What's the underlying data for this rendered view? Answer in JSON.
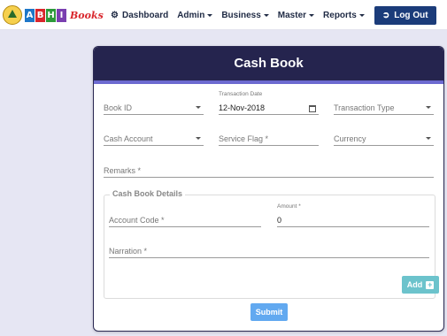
{
  "brand": {
    "letters": [
      "A",
      "B",
      "H",
      "I"
    ],
    "letter_colors": [
      "#1e77c8",
      "#d9262c",
      "#2d9a3a",
      "#7a3fb0"
    ],
    "suffix": "Books"
  },
  "nav": {
    "dashboard": {
      "label": "Dashboard",
      "icon": "dashboard-icon"
    },
    "admin": "Admin",
    "business": "Business",
    "master": "Master",
    "reports": "Reports",
    "logout": {
      "label": "Log Out",
      "icon": "logout-icon"
    }
  },
  "card": {
    "title": "Cash Book"
  },
  "form": {
    "book_id": {
      "label": "Book ID"
    },
    "transaction_date": {
      "label": "Transaction Date",
      "value": "12-Nov-2018",
      "icon": "calendar-icon"
    },
    "transaction_type": {
      "label": "Transaction Type"
    },
    "cash_account": {
      "label": "Cash Account"
    },
    "service_flag": {
      "label": "Service Flag *"
    },
    "currency": {
      "label": "Currency"
    },
    "remarks": {
      "label": "Remarks *"
    }
  },
  "details": {
    "legend": "Cash Book Details",
    "account_code": {
      "label": "Account Code *"
    },
    "amount": {
      "label": "Amount *",
      "value": "0"
    },
    "narration": {
      "label": "Narration *"
    },
    "add_button": {
      "label": "Add",
      "icon": "plus-icon"
    }
  },
  "submit": {
    "label": "Submit"
  },
  "colors": {
    "header": "#25244e",
    "accent": "#6c6ad0",
    "logout": "#1b3c7a",
    "add": "#6cc3cc",
    "submit": "#62a9f0",
    "background": "#e6e6f3"
  }
}
